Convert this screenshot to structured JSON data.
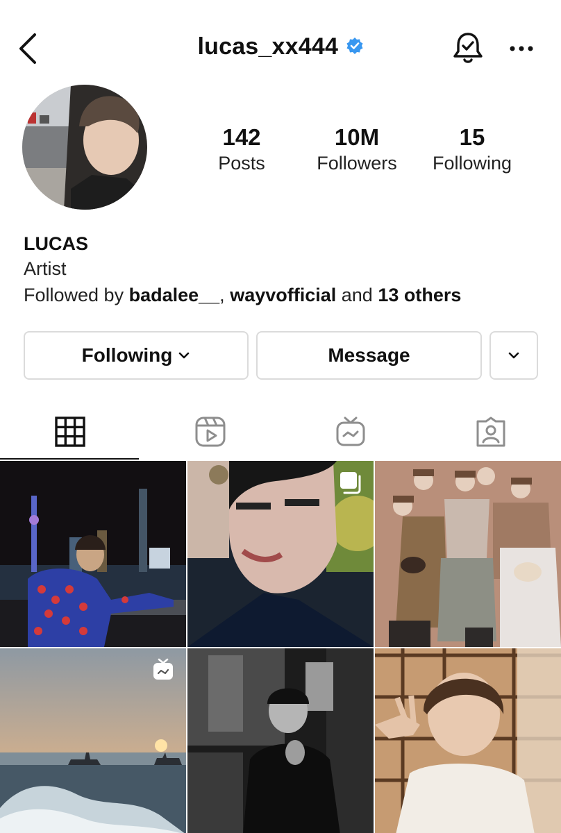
{
  "header": {
    "username": "lucas_xx444",
    "back_icon": "chevron-left-icon",
    "verified_icon": "verified-badge-icon",
    "bell_icon": "notification-bell-icon",
    "more_icon": "more-horizontal-icon"
  },
  "profile": {
    "stats": [
      {
        "value": "142",
        "label": "Posts"
      },
      {
        "value": "10M",
        "label": "Followers"
      },
      {
        "value": "15",
        "label": "Following"
      }
    ],
    "name": "LUCAS",
    "category": "Artist",
    "followed_prefix": "Followed by ",
    "followed_user1": "badalee__",
    "followed_sep": ", ",
    "followed_user2": "wayvofficial",
    "followed_and": " and ",
    "followed_others": "13 others"
  },
  "actions": {
    "following_label": "Following",
    "message_label": "Message"
  },
  "tabs": [
    {
      "icon": "grid-icon",
      "active": true
    },
    {
      "icon": "reels-icon",
      "active": false
    },
    {
      "icon": "igtv-icon",
      "active": false
    },
    {
      "icon": "tagged-icon",
      "active": false
    }
  ],
  "colors": {
    "verified": "#3897f0",
    "border": "#dbdbdb",
    "text": "#111111"
  }
}
